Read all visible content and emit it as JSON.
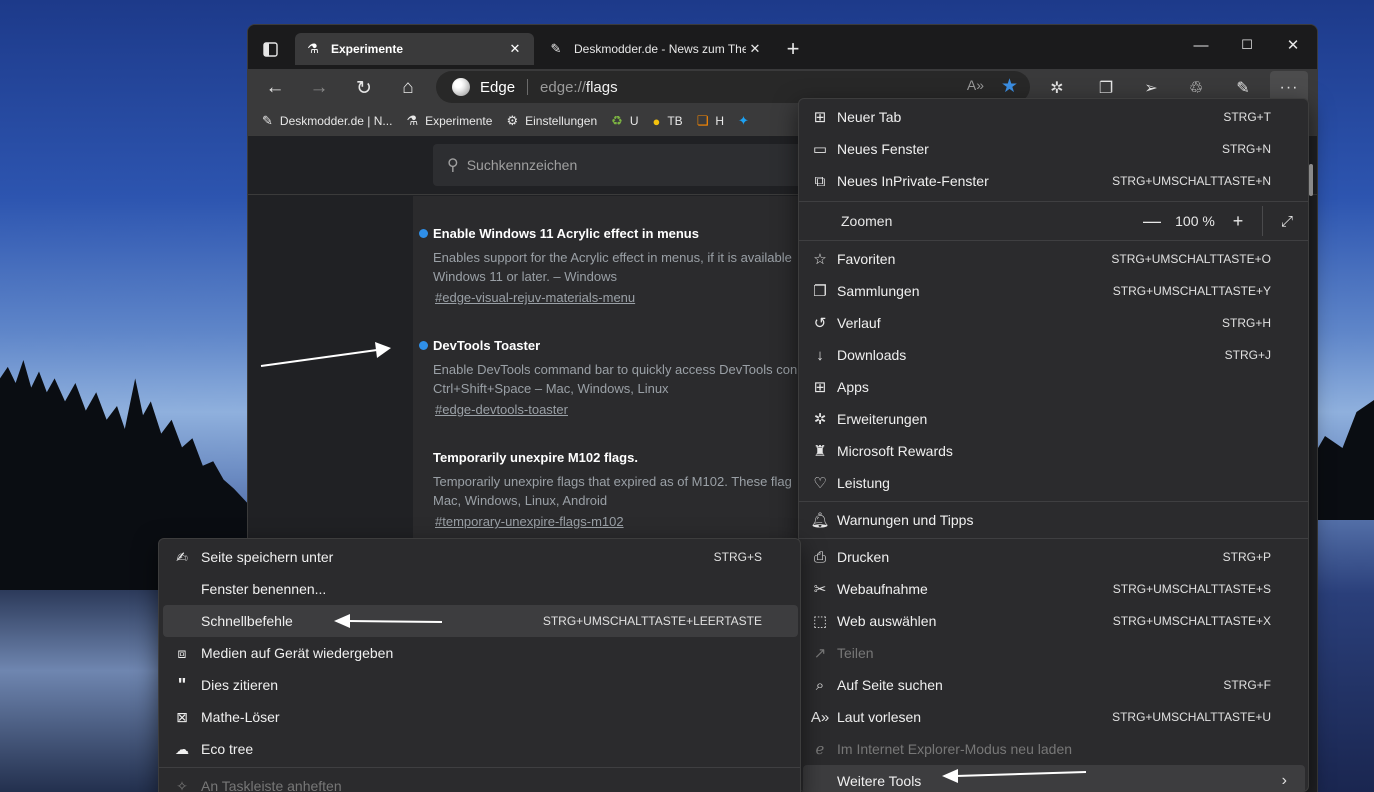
{
  "window": {
    "tabs": [
      {
        "title": "Experimente",
        "icon": "flask-icon",
        "active": true
      },
      {
        "title": "Deskmodder.de - News zum The",
        "icon": "brush-icon",
        "active": false
      }
    ],
    "controls": {
      "minimize": "—",
      "maximize": "☐",
      "close": "✕"
    }
  },
  "toolbar": {
    "brand": "Edge",
    "url_prefix": "edge://",
    "url_path": "flags"
  },
  "favorites": [
    {
      "label": "Deskmodder.de | N...",
      "icon": "brush-icon"
    },
    {
      "label": "Experimente",
      "icon": "flask-icon"
    },
    {
      "label": "Einstellungen",
      "icon": "gear-icon"
    },
    {
      "label": "U",
      "icon": "recycle-icon"
    },
    {
      "label": "TB",
      "icon": "coin-icon"
    },
    {
      "label": "H",
      "icon": "stack-icon"
    },
    {
      "label": "",
      "icon": "twitter-icon"
    }
  ],
  "flags_page": {
    "search_placeholder": "Suchkennzeichen",
    "flags": [
      {
        "title": "Enable Windows 11 Acrylic effect in menus",
        "desc1": "Enables support for the Acrylic effect in menus, if it is available",
        "desc2": "Windows 11 or later. – Windows",
        "link": "#edge-visual-rejuv-materials-menu",
        "modified": true
      },
      {
        "title": "DevTools Toaster",
        "desc1": "Enable DevTools command bar to quickly access DevTools con",
        "desc2": "Ctrl+Shift+Space – Mac, Windows, Linux",
        "link": "#edge-devtools-toaster",
        "modified": true
      },
      {
        "title": "Temporarily unexpire M102 flags.",
        "desc1": "Temporarily unexpire flags that expired as of M102. These flag",
        "desc2": "Mac, Windows, Linux, Android",
        "link": "#temporary-unexpire-flags-m102",
        "modified": false
      }
    ]
  },
  "main_menu": {
    "items": [
      {
        "label": "Neuer Tab",
        "shortcut": "STRG+T",
        "icon": "new-tab-icon"
      },
      {
        "label": "Neues Fenster",
        "shortcut": "STRG+N",
        "icon": "new-window-icon"
      },
      {
        "label": "Neues InPrivate-Fenster",
        "shortcut": "STRG+UMSCHALTTASTE+N",
        "icon": "inprivate-icon"
      }
    ],
    "zoom": {
      "label": "Zoomen",
      "minus": "—",
      "value": "100 %",
      "plus": "+",
      "fullscreen": "⤢"
    },
    "items2": [
      {
        "label": "Favoriten",
        "shortcut": "STRG+UMSCHALTTASTE+O",
        "icon": "favorites-icon"
      },
      {
        "label": "Sammlungen",
        "shortcut": "STRG+UMSCHALTTASTE+Y",
        "icon": "collections-icon"
      },
      {
        "label": "Verlauf",
        "shortcut": "STRG+H",
        "icon": "history-icon"
      },
      {
        "label": "Downloads",
        "shortcut": "STRG+J",
        "icon": "download-icon"
      },
      {
        "label": "Apps",
        "shortcut": "",
        "icon": "apps-icon"
      },
      {
        "label": "Erweiterungen",
        "shortcut": "",
        "icon": "extensions-icon"
      },
      {
        "label": "Microsoft Rewards",
        "shortcut": "",
        "icon": "rewards-icon"
      },
      {
        "label": "Leistung",
        "shortcut": "",
        "icon": "performance-icon"
      }
    ],
    "items3": [
      {
        "label": "Warnungen und Tipps",
        "shortcut": "",
        "icon": "bell-icon"
      }
    ],
    "items4": [
      {
        "label": "Drucken",
        "shortcut": "STRG+P",
        "icon": "printer-icon"
      },
      {
        "label": "Webaufnahme",
        "shortcut": "STRG+UMSCHALTTASTE+S",
        "icon": "web-capture-icon"
      },
      {
        "label": "Web auswählen",
        "shortcut": "STRG+UMSCHALTTASTE+X",
        "icon": "web-select-icon"
      },
      {
        "label": "Teilen",
        "shortcut": "",
        "icon": "share-icon",
        "disabled": true
      },
      {
        "label": "Auf Seite suchen",
        "shortcut": "STRG+F",
        "icon": "find-icon"
      },
      {
        "label": "Laut vorlesen",
        "shortcut": "STRG+UMSCHALTTASTE+U",
        "icon": "read-aloud-icon"
      },
      {
        "label": "Im Internet Explorer-Modus neu laden",
        "shortcut": "",
        "icon": "ie-mode-icon",
        "disabled": true
      },
      {
        "label": "Weitere Tools",
        "shortcut": "›",
        "icon": "",
        "highlight": true
      }
    ]
  },
  "sub_menu": {
    "items": [
      {
        "label": "Seite speichern unter",
        "shortcut": "STRG+S",
        "icon": "save-icon"
      },
      {
        "label": "Fenster benennen...",
        "shortcut": "",
        "icon": ""
      },
      {
        "label": "Schnellbefehle",
        "shortcut": "STRG+UMSCHALTTASTE+LEERTASTE",
        "icon": "",
        "highlight": true
      },
      {
        "label": "Medien auf Gerät wiedergeben",
        "shortcut": "",
        "icon": "cast-icon"
      },
      {
        "label": "Dies zitieren",
        "shortcut": "",
        "icon": "quote-icon"
      },
      {
        "label": "Mathe-Löser",
        "shortcut": "",
        "icon": "math-icon"
      },
      {
        "label": "Eco tree",
        "shortcut": "",
        "icon": "cloud-icon"
      },
      {
        "label": "An Taskleiste anheften",
        "shortcut": "",
        "icon": "pin-icon",
        "disabled": true
      }
    ]
  }
}
